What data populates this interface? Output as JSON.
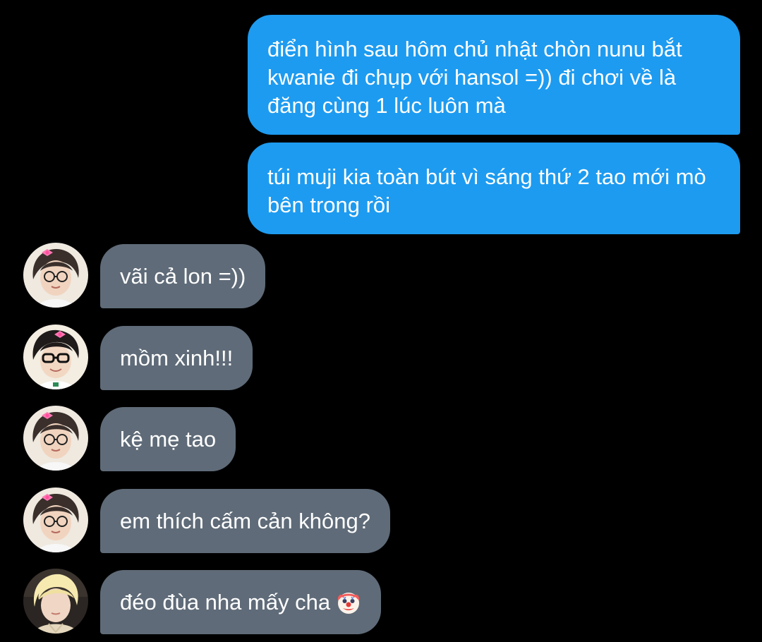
{
  "colors": {
    "background": "#000000",
    "outgoing_bubble": "#1d9bf0",
    "incoming_bubble": "#5f6b78",
    "text": "#ffffff"
  },
  "messages": [
    {
      "direction": "outgoing",
      "text": "điển hình sau hôm chủ nhật chòn nunu bắt kwanie đi chụp với hansol =)) đi chơi về là đăng cùng 1 lúc luôn mà"
    },
    {
      "direction": "outgoing",
      "text": "túi muji kia toàn bút vì sáng thứ 2 tao mới mò bên trong rồi"
    },
    {
      "direction": "incoming",
      "avatar": "avatar-glasses-bow",
      "text": "vãi cả lon =))"
    },
    {
      "direction": "incoming",
      "avatar": "avatar-black-glasses-bow",
      "text": "mồm xinh!!!"
    },
    {
      "direction": "incoming",
      "avatar": "avatar-glasses-bow",
      "text": "kệ mẹ tao"
    },
    {
      "direction": "incoming",
      "avatar": "avatar-glasses-bow",
      "text": "em thích cấm cản không?"
    },
    {
      "direction": "incoming",
      "avatar": "avatar-blonde",
      "text": "đéo đùa nha mấy cha",
      "emoji": "clown-face-icon"
    }
  ]
}
